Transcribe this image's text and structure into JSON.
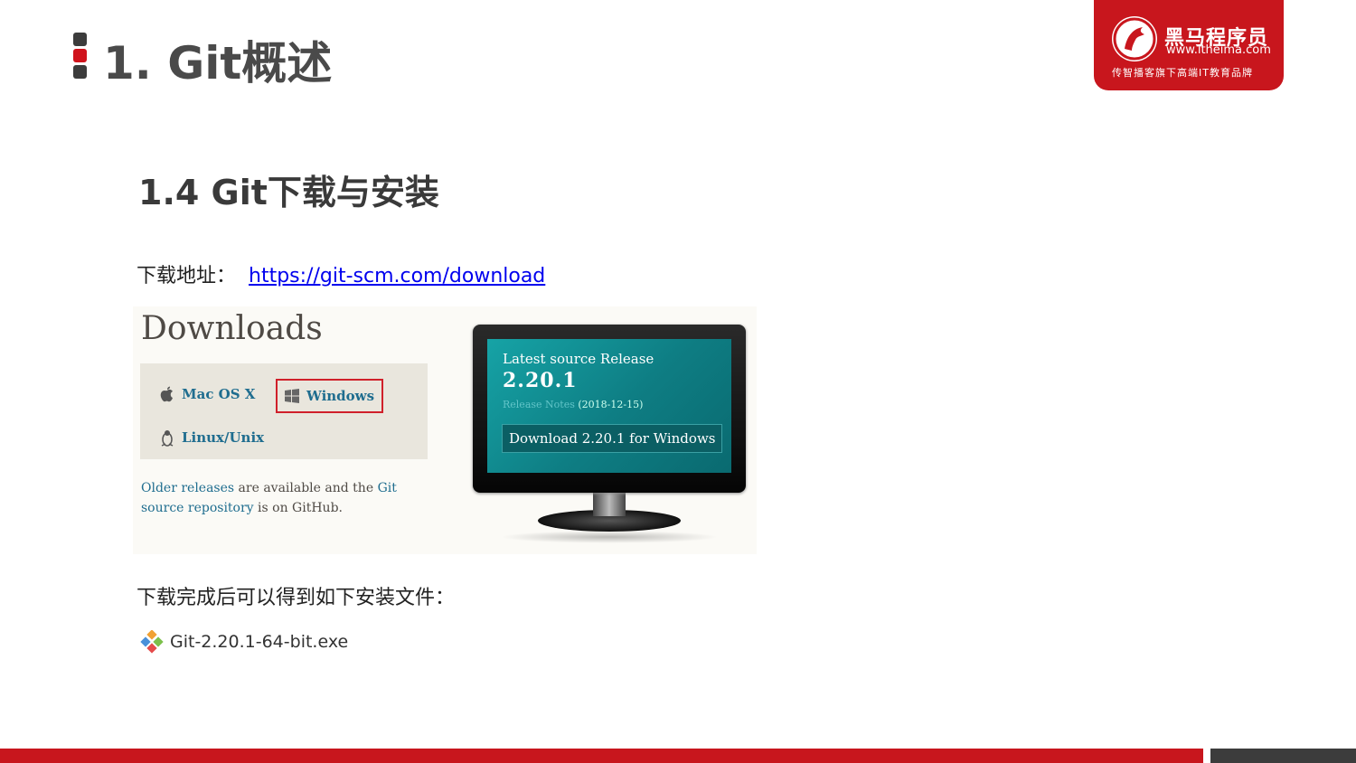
{
  "page": {
    "title": "1. Git概述",
    "section_title": "1.4 Git下载与安装",
    "download_label": "下载地址：",
    "download_url": "https://git-scm.com/download",
    "after_text": "下载完成后可以得到如下安装文件：",
    "file_name": "Git-2.20.1-64-bit.exe"
  },
  "logo": {
    "name": "黑马程序员",
    "url": "www.itheima.com",
    "tagline": "传智播客旗下高端IT教育品牌"
  },
  "downloads_panel": {
    "heading": "Downloads",
    "os_options": [
      "Mac OS X",
      "Windows",
      "Linux/Unix"
    ],
    "older_text_1": "Older releases",
    "older_text_2": " are available and the ",
    "older_text_3": "Git source repository",
    "older_text_4": " is on GitHub.",
    "latest_label": "Latest source Release",
    "version": "2.20.1",
    "release_notes_label": "Release Notes",
    "release_date": "(2018-12-15)",
    "download_button": "Download 2.20.1 for Windows"
  },
  "colors": {
    "brand_red": "#c8161d",
    "dark_gray": "#3c3c3c",
    "link_blue": "#0000ee",
    "git_teal": "#0e7d83"
  }
}
